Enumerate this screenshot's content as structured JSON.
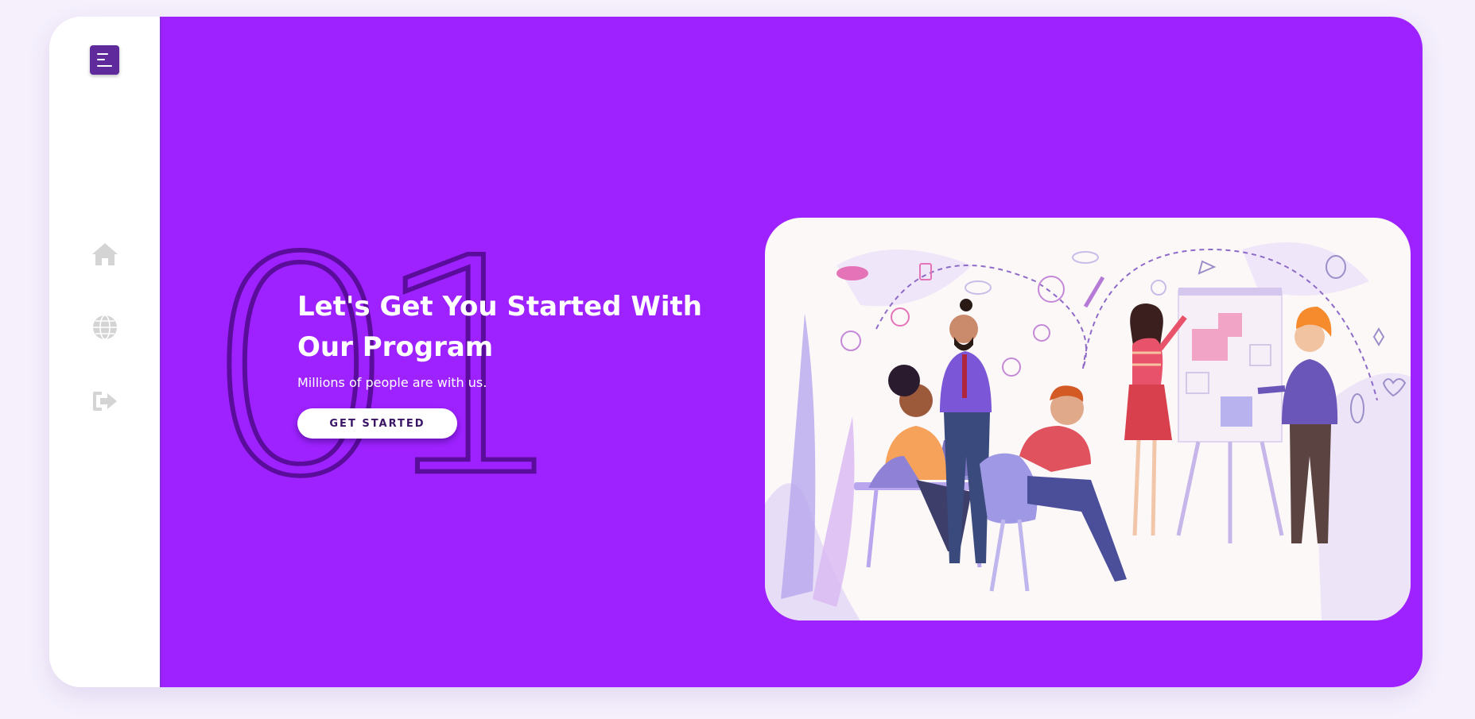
{
  "sidebar": {
    "items": [
      {
        "icon": "home-icon"
      },
      {
        "icon": "globe-icon"
      },
      {
        "icon": "logout-icon"
      }
    ]
  },
  "hero": {
    "number": "01",
    "title": "Let's Get You Started With Our Program",
    "subtitle": "Millions of people are with us.",
    "cta_label": "GET STARTED"
  },
  "colors": {
    "accent": "#9e22ff",
    "menu_button": "#5f2a9c",
    "number_outline": "#5a0c9a",
    "sidebar_icon": "#d4d4d4"
  }
}
